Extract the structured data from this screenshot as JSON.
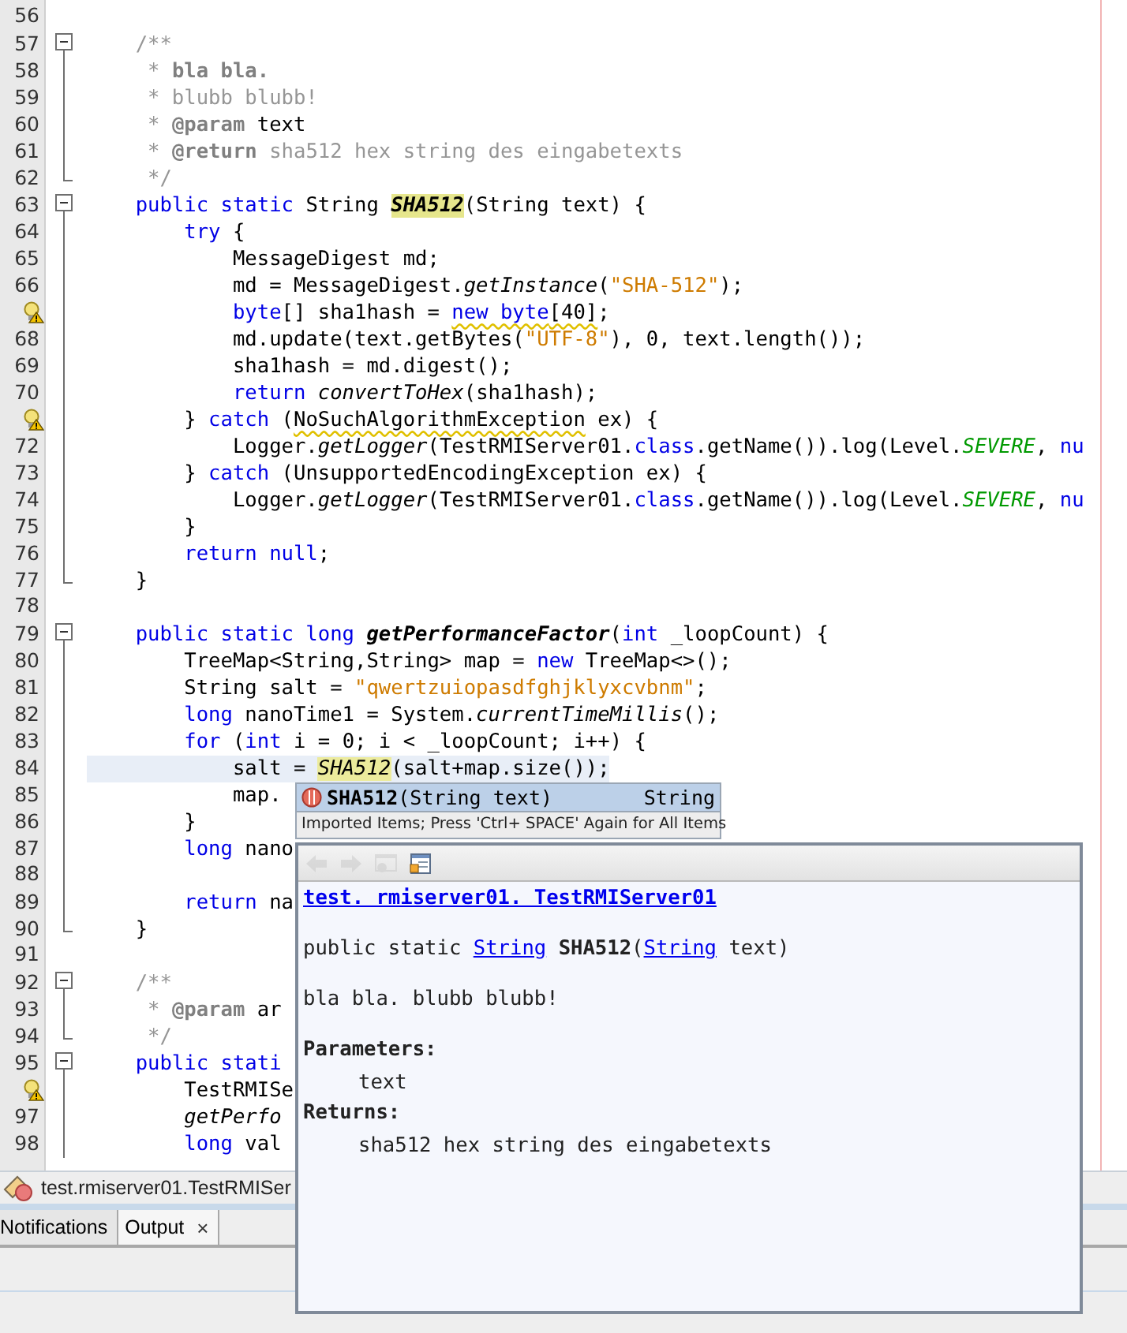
{
  "editor": {
    "lines": [
      {
        "num": "56"
      },
      {
        "num": "57",
        "fold_start": true,
        "tokens": [
          {
            "kind": "c",
            "text": "    /**"
          }
        ]
      },
      {
        "num": "58",
        "in_fold": true,
        "tokens": [
          {
            "kind": "c",
            "text": "     * "
          },
          {
            "kind": "cb",
            "text": "bla bla."
          }
        ]
      },
      {
        "num": "59",
        "in_fold": true,
        "tokens": [
          {
            "kind": "c",
            "text": "     * blubb blubb!"
          }
        ]
      },
      {
        "num": "60",
        "in_fold": true,
        "tokens": [
          {
            "kind": "c",
            "text": "     * "
          },
          {
            "kind": "cb",
            "text": "@param"
          },
          {
            "kind": "p",
            "text": " text"
          }
        ]
      },
      {
        "num": "61",
        "in_fold": true,
        "tokens": [
          {
            "kind": "c",
            "text": "     * "
          },
          {
            "kind": "cb",
            "text": "@return"
          },
          {
            "kind": "c",
            "text": " sha512 hex string des eingabetexts"
          }
        ]
      },
      {
        "num": "62",
        "fold_end": true,
        "tokens": [
          {
            "kind": "c",
            "text": "     */"
          }
        ]
      },
      {
        "num": "63",
        "fold_start": true,
        "tokens": [
          {
            "kind": "k",
            "text": "    public static"
          },
          {
            "kind": "p",
            "text": " String "
          },
          {
            "kind": "m",
            "text": "SHA512"
          },
          {
            "kind": "p",
            "text": "(String text) {"
          }
        ]
      },
      {
        "num": "64",
        "in_fold": true,
        "tokens": [
          {
            "kind": "k",
            "text": "        try"
          },
          {
            "kind": "p",
            "text": " {"
          }
        ]
      },
      {
        "num": "65",
        "in_fold": true,
        "tokens": [
          {
            "kind": "p",
            "text": "            MessageDigest md;"
          }
        ]
      },
      {
        "num": "66",
        "in_fold": true,
        "tokens": [
          {
            "kind": "p",
            "text": "            md = MessageDigest."
          },
          {
            "kind": "i",
            "text": "getInstance"
          },
          {
            "kind": "p",
            "text": "("
          },
          {
            "kind": "s",
            "text": "\"SHA-512\""
          },
          {
            "kind": "p",
            "text": ");"
          }
        ]
      },
      {
        "hint": true,
        "in_fold": true,
        "tokens": [
          {
            "kind": "k",
            "text": "            byte"
          },
          {
            "kind": "p",
            "text": "[] sha1hash = "
          },
          {
            "kind": "kw",
            "text": "new byte"
          },
          {
            "kind": "w",
            "text": "[40]"
          },
          {
            "kind": "p",
            "text": ";"
          }
        ]
      },
      {
        "num": "68",
        "in_fold": true,
        "tokens": [
          {
            "kind": "p",
            "text": "            md.update(text.getBytes("
          },
          {
            "kind": "s",
            "text": "\"UTF-8\""
          },
          {
            "kind": "p",
            "text": "), 0, text.length());"
          }
        ]
      },
      {
        "num": "69",
        "in_fold": true,
        "tokens": [
          {
            "kind": "p",
            "text": "            sha1hash = md.digest();"
          }
        ]
      },
      {
        "num": "70",
        "in_fold": true,
        "tokens": [
          {
            "kind": "k",
            "text": "            return"
          },
          {
            "kind": "i",
            "text": " convertToHex"
          },
          {
            "kind": "p",
            "text": "(sha1hash);"
          }
        ]
      },
      {
        "hint": true,
        "in_fold": true,
        "tokens": [
          {
            "kind": "p",
            "text": "        } "
          },
          {
            "kind": "k",
            "text": "catch"
          },
          {
            "kind": "p",
            "text": " ("
          },
          {
            "kind": "w",
            "text": "NoSuchAlgorithmException"
          },
          {
            "kind": "p",
            "text": " ex) {"
          }
        ]
      },
      {
        "num": "72",
        "in_fold": true,
        "tokens": [
          {
            "kind": "p",
            "text": "            Logger."
          },
          {
            "kind": "i",
            "text": "getLogger"
          },
          {
            "kind": "p",
            "text": "(TestRMIServer01."
          },
          {
            "kind": "k",
            "text": "class"
          },
          {
            "kind": "p",
            "text": ".getName()).log(Level."
          },
          {
            "kind": "f",
            "text": "SEVERE"
          },
          {
            "kind": "p",
            "text": ","
          },
          {
            "kind": "k",
            "text": " nu"
          }
        ]
      },
      {
        "num": "73",
        "in_fold": true,
        "tokens": [
          {
            "kind": "p",
            "text": "        } "
          },
          {
            "kind": "k",
            "text": "catch"
          },
          {
            "kind": "p",
            "text": " (UnsupportedEncodingException ex) {"
          }
        ]
      },
      {
        "num": "74",
        "in_fold": true,
        "tokens": [
          {
            "kind": "p",
            "text": "            Logger."
          },
          {
            "kind": "i",
            "text": "getLogger"
          },
          {
            "kind": "p",
            "text": "(TestRMIServer01."
          },
          {
            "kind": "k",
            "text": "class"
          },
          {
            "kind": "p",
            "text": ".getName()).log(Level."
          },
          {
            "kind": "f",
            "text": "SEVERE"
          },
          {
            "kind": "p",
            "text": ","
          },
          {
            "kind": "k",
            "text": " nu"
          }
        ]
      },
      {
        "num": "75",
        "in_fold": true,
        "tokens": [
          {
            "kind": "p",
            "text": "        }"
          }
        ]
      },
      {
        "num": "76",
        "in_fold": true,
        "tokens": [
          {
            "kind": "k",
            "text": "        return null"
          },
          {
            "kind": "p",
            "text": ";"
          }
        ]
      },
      {
        "num": "77",
        "fold_end": true,
        "tokens": [
          {
            "kind": "p",
            "text": "    }"
          }
        ]
      },
      {
        "num": "78"
      },
      {
        "num": "79",
        "fold_start": true,
        "tokens": [
          {
            "kind": "k",
            "text": "    public static long"
          },
          {
            "kind": "d",
            "text": " getPerformanceFactor"
          },
          {
            "kind": "p",
            "text": "("
          },
          {
            "kind": "k",
            "text": "int"
          },
          {
            "kind": "p",
            "text": " _loopCount) {"
          }
        ]
      },
      {
        "num": "80",
        "in_fold": true,
        "tokens": [
          {
            "kind": "p",
            "text": "        TreeMap<String,String> map = "
          },
          {
            "kind": "k",
            "text": "new"
          },
          {
            "kind": "p",
            "text": " TreeMap<>();"
          }
        ]
      },
      {
        "num": "81",
        "in_fold": true,
        "tokens": [
          {
            "kind": "p",
            "text": "        String salt = "
          },
          {
            "kind": "s",
            "text": "\"qwertzuiopasdfghjklyxcvbnm\""
          },
          {
            "kind": "p",
            "text": ";"
          }
        ]
      },
      {
        "num": "82",
        "in_fold": true,
        "tokens": [
          {
            "kind": "k",
            "text": "        long"
          },
          {
            "kind": "p",
            "text": " nanoTime1 = System."
          },
          {
            "kind": "i",
            "text": "currentTimeMillis"
          },
          {
            "kind": "p",
            "text": "();"
          }
        ]
      },
      {
        "num": "83",
        "in_fold": true,
        "tokens": [
          {
            "kind": "k",
            "text": "        for"
          },
          {
            "kind": "p",
            "text": " ("
          },
          {
            "kind": "k",
            "text": "int"
          },
          {
            "kind": "p",
            "text": " i = 0; i < _loopCount; i++) {"
          }
        ]
      },
      {
        "num": "84",
        "in_fold": true,
        "current": true,
        "tokens": [
          {
            "kind": "p",
            "text": "            salt = "
          },
          {
            "kind": "mi",
            "text": "SHA512"
          },
          {
            "kind": "p",
            "text": "(salt+map.size());"
          }
        ]
      },
      {
        "num": "85",
        "in_fold": true,
        "tokens": [
          {
            "kind": "p",
            "text": "            map."
          }
        ]
      },
      {
        "num": "86",
        "in_fold": true,
        "tokens": [
          {
            "kind": "p",
            "text": "        }"
          }
        ]
      },
      {
        "num": "87",
        "in_fold": true,
        "tokens": [
          {
            "kind": "k",
            "text": "        long"
          },
          {
            "kind": "p",
            "text": " nano"
          }
        ]
      },
      {
        "num": "88",
        "in_fold": true
      },
      {
        "num": "89",
        "in_fold": true,
        "tokens": [
          {
            "kind": "k",
            "text": "        return"
          },
          {
            "kind": "p",
            "text": " na"
          }
        ]
      },
      {
        "num": "90",
        "fold_end": true,
        "tokens": [
          {
            "kind": "p",
            "text": "    }"
          }
        ]
      },
      {
        "num": "91"
      },
      {
        "num": "92",
        "fold_start": true,
        "tokens": [
          {
            "kind": "c",
            "text": "    /**"
          }
        ]
      },
      {
        "num": "93",
        "in_fold": true,
        "tokens": [
          {
            "kind": "c",
            "text": "     * "
          },
          {
            "kind": "cb",
            "text": "@param"
          },
          {
            "kind": "p",
            "text": " ar"
          }
        ]
      },
      {
        "num": "94",
        "fold_end": true,
        "tokens": [
          {
            "kind": "c",
            "text": "     */"
          }
        ]
      },
      {
        "num": "95",
        "fold_start": true,
        "tokens": [
          {
            "kind": "k",
            "text": "    public stati"
          }
        ]
      },
      {
        "hint": true,
        "in_fold": true,
        "tokens": [
          {
            "kind": "p",
            "text": "        TestRMISe"
          }
        ]
      },
      {
        "num": "97",
        "in_fold": true,
        "tokens": [
          {
            "kind": "i",
            "text": "        getPerfo"
          }
        ]
      },
      {
        "num": "98",
        "in_fold": true,
        "tokens": [
          {
            "kind": "k",
            "text": "        long"
          },
          {
            "kind": "p",
            "text": " val"
          }
        ]
      }
    ]
  },
  "completion": {
    "items": [
      {
        "name": "SHA512",
        "params": "(String text)",
        "type": "String",
        "selected": true
      }
    ],
    "status": "Imported Items; Press 'Ctrl+ SPACE' Again for All Items"
  },
  "javadoc": {
    "toolbar": [
      {
        "kind": "back",
        "disabled": true
      },
      {
        "kind": "forward",
        "disabled": true
      },
      {
        "kind": "browser",
        "disabled": true
      },
      {
        "kind": "source",
        "disabled": false
      }
    ],
    "class_link": "test. rmiserver01. TestRMIServer01",
    "signature": [
      {
        "kind": "text",
        "text": "public static "
      },
      {
        "kind": "link",
        "text": "String"
      },
      {
        "kind": "bold",
        "text": " SHA512"
      },
      {
        "kind": "text",
        "text": "("
      },
      {
        "kind": "link",
        "text": "String"
      },
      {
        "kind": "text",
        "text": " text)"
      }
    ],
    "description": "bla bla. blubb blubb!",
    "params_heading": "Parameters:",
    "param": "text",
    "returns_heading": "Returns:",
    "returns": "sha512 hex string des eingabetexts"
  },
  "breadcrumb": "test.rmiserver01.TestRMISer",
  "output_tabs": [
    {
      "label": "Notifications",
      "selected": false
    },
    {
      "label": "Output",
      "selected": true,
      "close": "×"
    }
  ]
}
